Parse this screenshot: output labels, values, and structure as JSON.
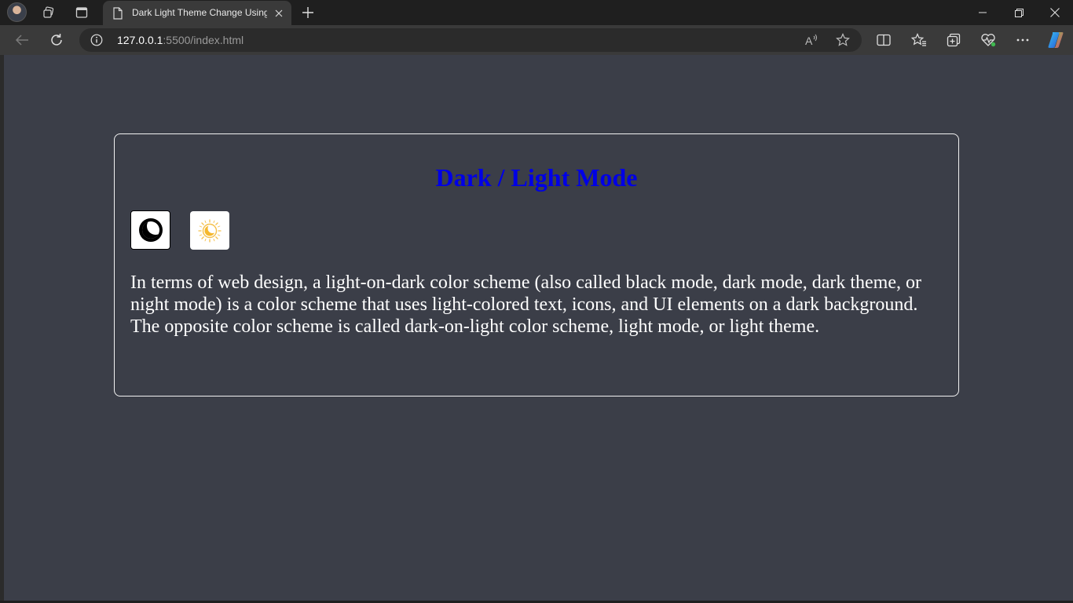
{
  "browser": {
    "tab": {
      "title": "Dark Light Theme Change Using JavaScript"
    },
    "address": {
      "host": "127.0.0.1",
      "rest": ":5500/index.html"
    }
  },
  "icons": {
    "tabstrip": [
      "profile-avatar-icon",
      "workspaces-icon",
      "tab-actions-icon",
      "page-icon",
      "close-icon",
      "plus-icon"
    ],
    "window": [
      "minimize-icon",
      "restore-icon",
      "close-icon"
    ],
    "toolbar": [
      "back-icon",
      "refresh-icon",
      "info-icon",
      "read-aloud-icon",
      "favorite-star-icon",
      "split-screen-icon",
      "favorites-icon",
      "collections-icon",
      "browser-essentials-icon",
      "more-icon",
      "copilot-icon"
    ],
    "page": [
      "moon-icon",
      "sun-moon-icon"
    ]
  },
  "colors": {
    "page_background": "#3b3e48",
    "heading": "#0000e6",
    "text": "#ffffff",
    "sun": "#f5b82e"
  },
  "page": {
    "heading": "Dark / Light Mode",
    "description": "In terms of web design, a light-on-dark color scheme (also called black mode, dark mode, dark theme, or night mode) is a color scheme that uses light-colored text, icons, and UI elements on a dark background. The opposite color scheme is called dark-on-light color scheme, light mode, or light theme."
  }
}
